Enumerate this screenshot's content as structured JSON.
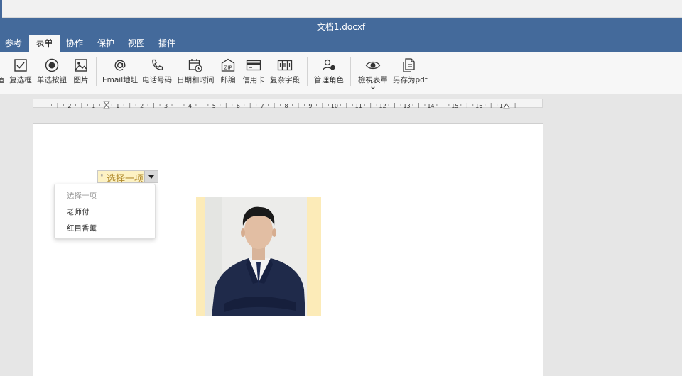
{
  "window": {
    "title": "文档1.docxf"
  },
  "tabs": [
    {
      "label": "参考"
    },
    {
      "label": "表单"
    },
    {
      "label": "协作"
    },
    {
      "label": "保护"
    },
    {
      "label": "视图"
    },
    {
      "label": "插件"
    }
  ],
  "active_tab": "表单",
  "toolbar": {
    "partial_label": "鱼",
    "items": [
      {
        "label": "复选框",
        "icon": "checkbox-icon"
      },
      {
        "label": "单选按钮",
        "icon": "radio-button-icon"
      },
      {
        "label": "图片",
        "icon": "image-icon"
      },
      {
        "label": "Email地址",
        "icon": "at-sign-icon"
      },
      {
        "label": "电话号码",
        "icon": "phone-icon"
      },
      {
        "label": "日期和时间",
        "icon": "calendar-clock-icon"
      },
      {
        "label": "邮编",
        "icon": "zip-icon"
      },
      {
        "label": "信用卡",
        "icon": "credit-card-icon"
      },
      {
        "label": "复杂字段",
        "icon": "complex-field-icon"
      },
      {
        "label": "管理角色",
        "icon": "manage-roles-icon"
      },
      {
        "label": "檢視表單",
        "icon": "eye-icon"
      },
      {
        "label": "另存为pdf",
        "icon": "save-pdf-icon"
      }
    ]
  },
  "ruler": {
    "marks": [
      "2",
      "1",
      "1",
      "2",
      "3",
      "4",
      "5",
      "6",
      "7",
      "8",
      "9",
      "10",
      "11",
      "12",
      "13",
      "14",
      "15",
      "16",
      "17"
    ]
  },
  "document": {
    "combo_box": {
      "selected_text": "选择一项",
      "options": [
        "选择一项",
        "老师付",
        "红目香薰"
      ]
    },
    "image_alt": "person-photo"
  },
  "colors": {
    "title_bar": "#446a9b",
    "highlight": "#fdf2c4",
    "photo_background": "#fcebb8"
  }
}
